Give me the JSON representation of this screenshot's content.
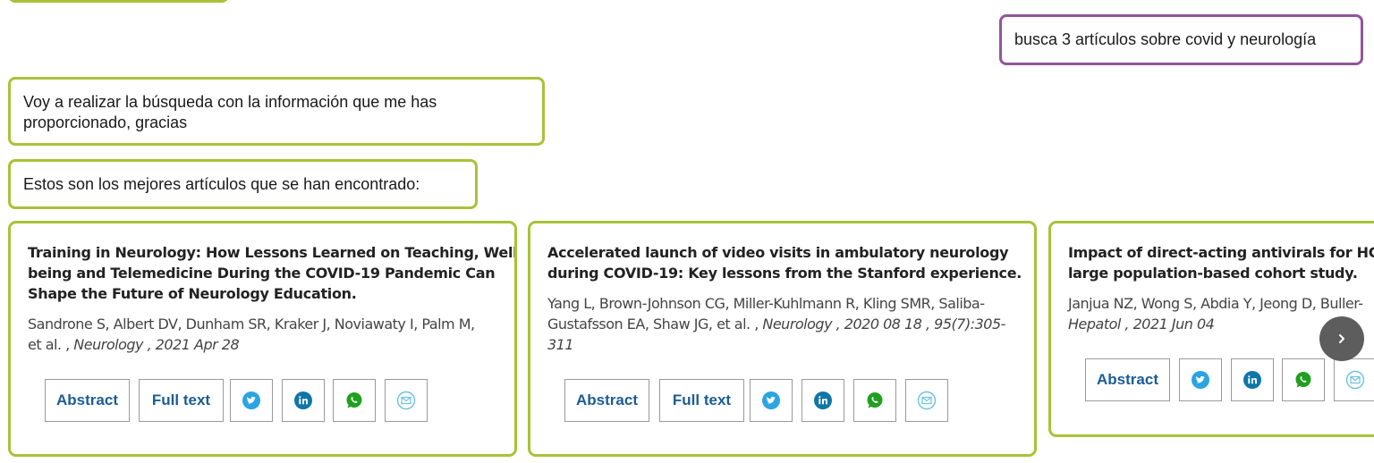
{
  "chat": {
    "user_message": "busca 3 artículos sobre covid y neurología",
    "bot_messages": [
      "Voy a realizar la búsqueda con la información que me has proporcionado, gracias",
      "Estos son los mejores artículos que se han encontrado:"
    ]
  },
  "articles": [
    {
      "title_lines": [
        "Training in Neurology: How Lessons Learned on Teaching, Well-",
        "being and Telemedicine During the COVID-19 Pandemic Can",
        "Shape the Future of Neurology Education."
      ],
      "authors_lines": [
        "Sandrone S, Albert DV, Dunham SR, Kraker J, Noviawaty I, Palm M,",
        "et al. , "
      ],
      "citation_lines": [
        "",
        "Neurology , 2021 Apr 28"
      ],
      "buttons": {
        "abstract": "Abstract",
        "full_text": "Full text"
      }
    },
    {
      "title_lines": [
        "Accelerated launch of video visits in ambulatory neurology",
        "during COVID-19: Key lessons from the Stanford experience."
      ],
      "authors_lines": [
        "Yang L, Brown-Johnson CG, Miller-Kuhlmann R, Kling SMR, Saliba-",
        "Gustafsson EA, Shaw JG, et al. , ",
        ""
      ],
      "citation_lines": [
        "",
        "Neurology , 2020 08 18 , 95(7):305-",
        "311"
      ],
      "buttons": {
        "abstract": "Abstract",
        "full_text": "Full text"
      }
    },
    {
      "title_lines": [
        "Impact of direct-acting antivirals for HCV",
        "large population-based cohort study."
      ],
      "authors_lines": [
        "Janjua NZ, Wong S, Abdia Y, Jeong D, Buller-",
        ""
      ],
      "citation_lines": [
        "",
        "Hepatol , 2021 Jun 04"
      ],
      "buttons": {
        "abstract": "Abstract"
      }
    }
  ],
  "icons": {
    "share": [
      "twitter-icon",
      "linkedin-icon",
      "whatsapp-icon",
      "email-icon"
    ],
    "carousel_next": "chevron-right-icon"
  },
  "colors": {
    "bot_border": "#a8c238",
    "user_border": "#93559c",
    "link": "#1b5c96",
    "twitter": "#2ca4e1",
    "linkedin": "#0e76a8",
    "whatsapp": "#1fa01f",
    "email": "#6cc3dd"
  }
}
